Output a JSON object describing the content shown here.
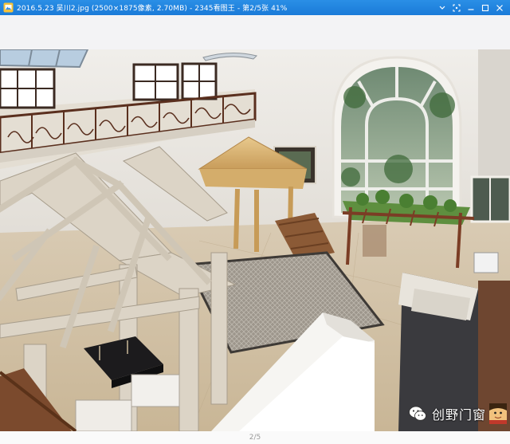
{
  "window": {
    "title": "2016.5.23 吴川2.jpg (2500×1875像素, 2.70MB) - 2345看图王 - 第2/5张 41%",
    "controls": [
      "restore-icon",
      "fit-icon",
      "minimize-icon",
      "maximize-icon",
      "close-icon"
    ]
  },
  "watermark": {
    "text": "创野门窗",
    "logo_icon": "wechat-icon"
  },
  "status": {
    "page_indicator": "2/5"
  },
  "colors": {
    "titlebar": "#1f84de",
    "toolbar": "#f3f3f5",
    "wall": "#e9e7e2",
    "wood": "#8a5a3a",
    "pergola_frame": "#d8d1c4"
  }
}
